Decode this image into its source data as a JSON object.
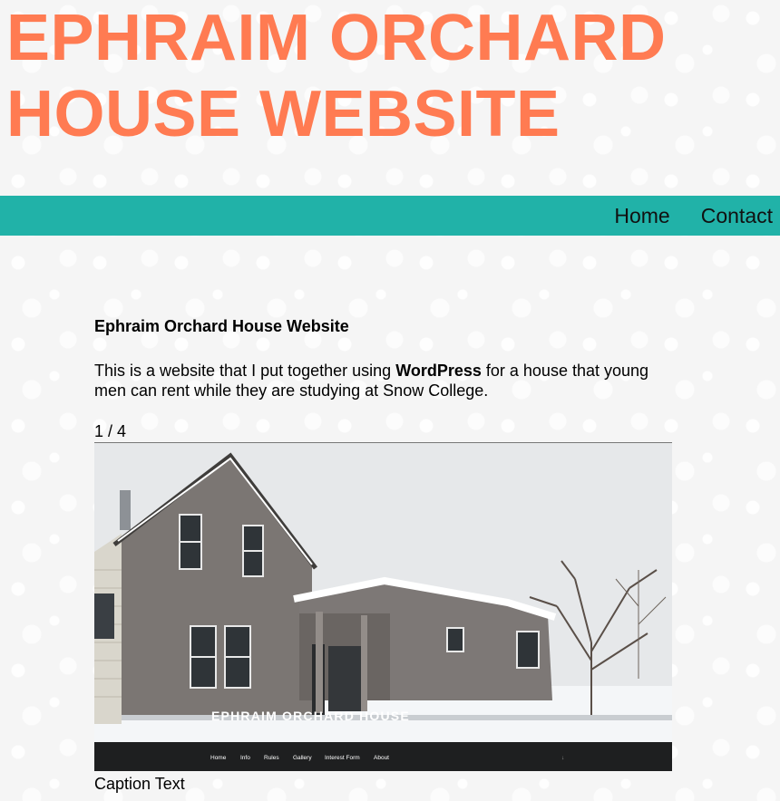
{
  "site": {
    "title": "EPHRAIM ORCHARD HOUSE WEBSITE",
    "title_color": "#ff7b52"
  },
  "nav": {
    "background": "#21b2a8",
    "items": [
      {
        "label": "Home"
      },
      {
        "label": "Contact"
      }
    ]
  },
  "post": {
    "title": "Ephraim Orchard House Website",
    "intro_before": "This is a website that I put together using ",
    "intro_bold": "WordPress",
    "intro_after": " for a house that young men can rent while they are studying at Snow College."
  },
  "slideshow": {
    "counter": "1 / 4",
    "caption": "Caption Text",
    "slide": {
      "overlay_title": "EPHRAIM ORCHARD HOUSE",
      "menu": [
        "Home",
        "Info",
        "Rules",
        "Gallery",
        "Interest Form",
        "About"
      ],
      "menu_arrow": "↓"
    }
  }
}
